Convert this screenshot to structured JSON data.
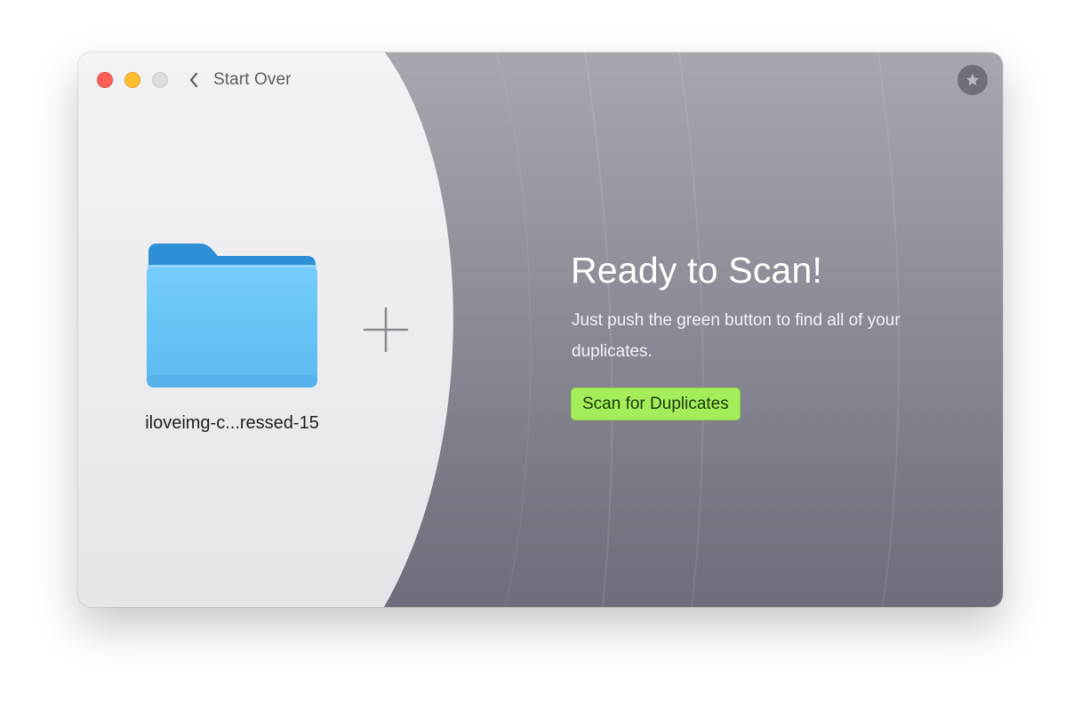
{
  "toolbar": {
    "back_label": "Start Over"
  },
  "source": {
    "folder_name": "iloveimg-c...ressed-15"
  },
  "main": {
    "headline": "Ready to Scan!",
    "subtext": "Just push the green button to find all of your duplicates.",
    "scan_button_label": "Scan for Duplicates"
  },
  "icons": {
    "back": "chevron-left-icon",
    "folder": "folder-icon",
    "add": "plus-icon",
    "favorite": "star-icon"
  },
  "colors": {
    "scan_button": "#a4ee5c",
    "close": "#fe5f57",
    "minimize": "#febc2e",
    "folder": "#6ac3f6"
  }
}
